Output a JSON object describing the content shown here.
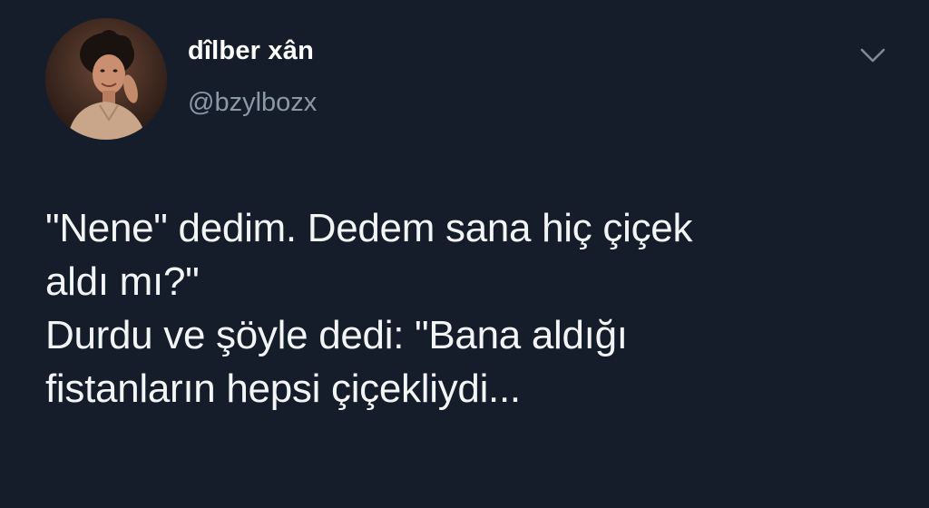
{
  "user": {
    "display_name": "dîlber xân",
    "handle": "@bzylbozx",
    "avatar": "profile-photo"
  },
  "menu": {
    "icon": "chevron-down-icon"
  },
  "tweet": {
    "lines": [
      "\"Nene\" dedim. Dedem sana hiç çiçek",
      "aldı mı?\"",
      "Durdu ve şöyle dedi: \"Bana aldığı",
      "fistanların hepsi çiçekliydi..."
    ]
  },
  "colors": {
    "background": "#151d2b",
    "text": "#f2f4f6",
    "secondary_text": "#8b98a5"
  }
}
